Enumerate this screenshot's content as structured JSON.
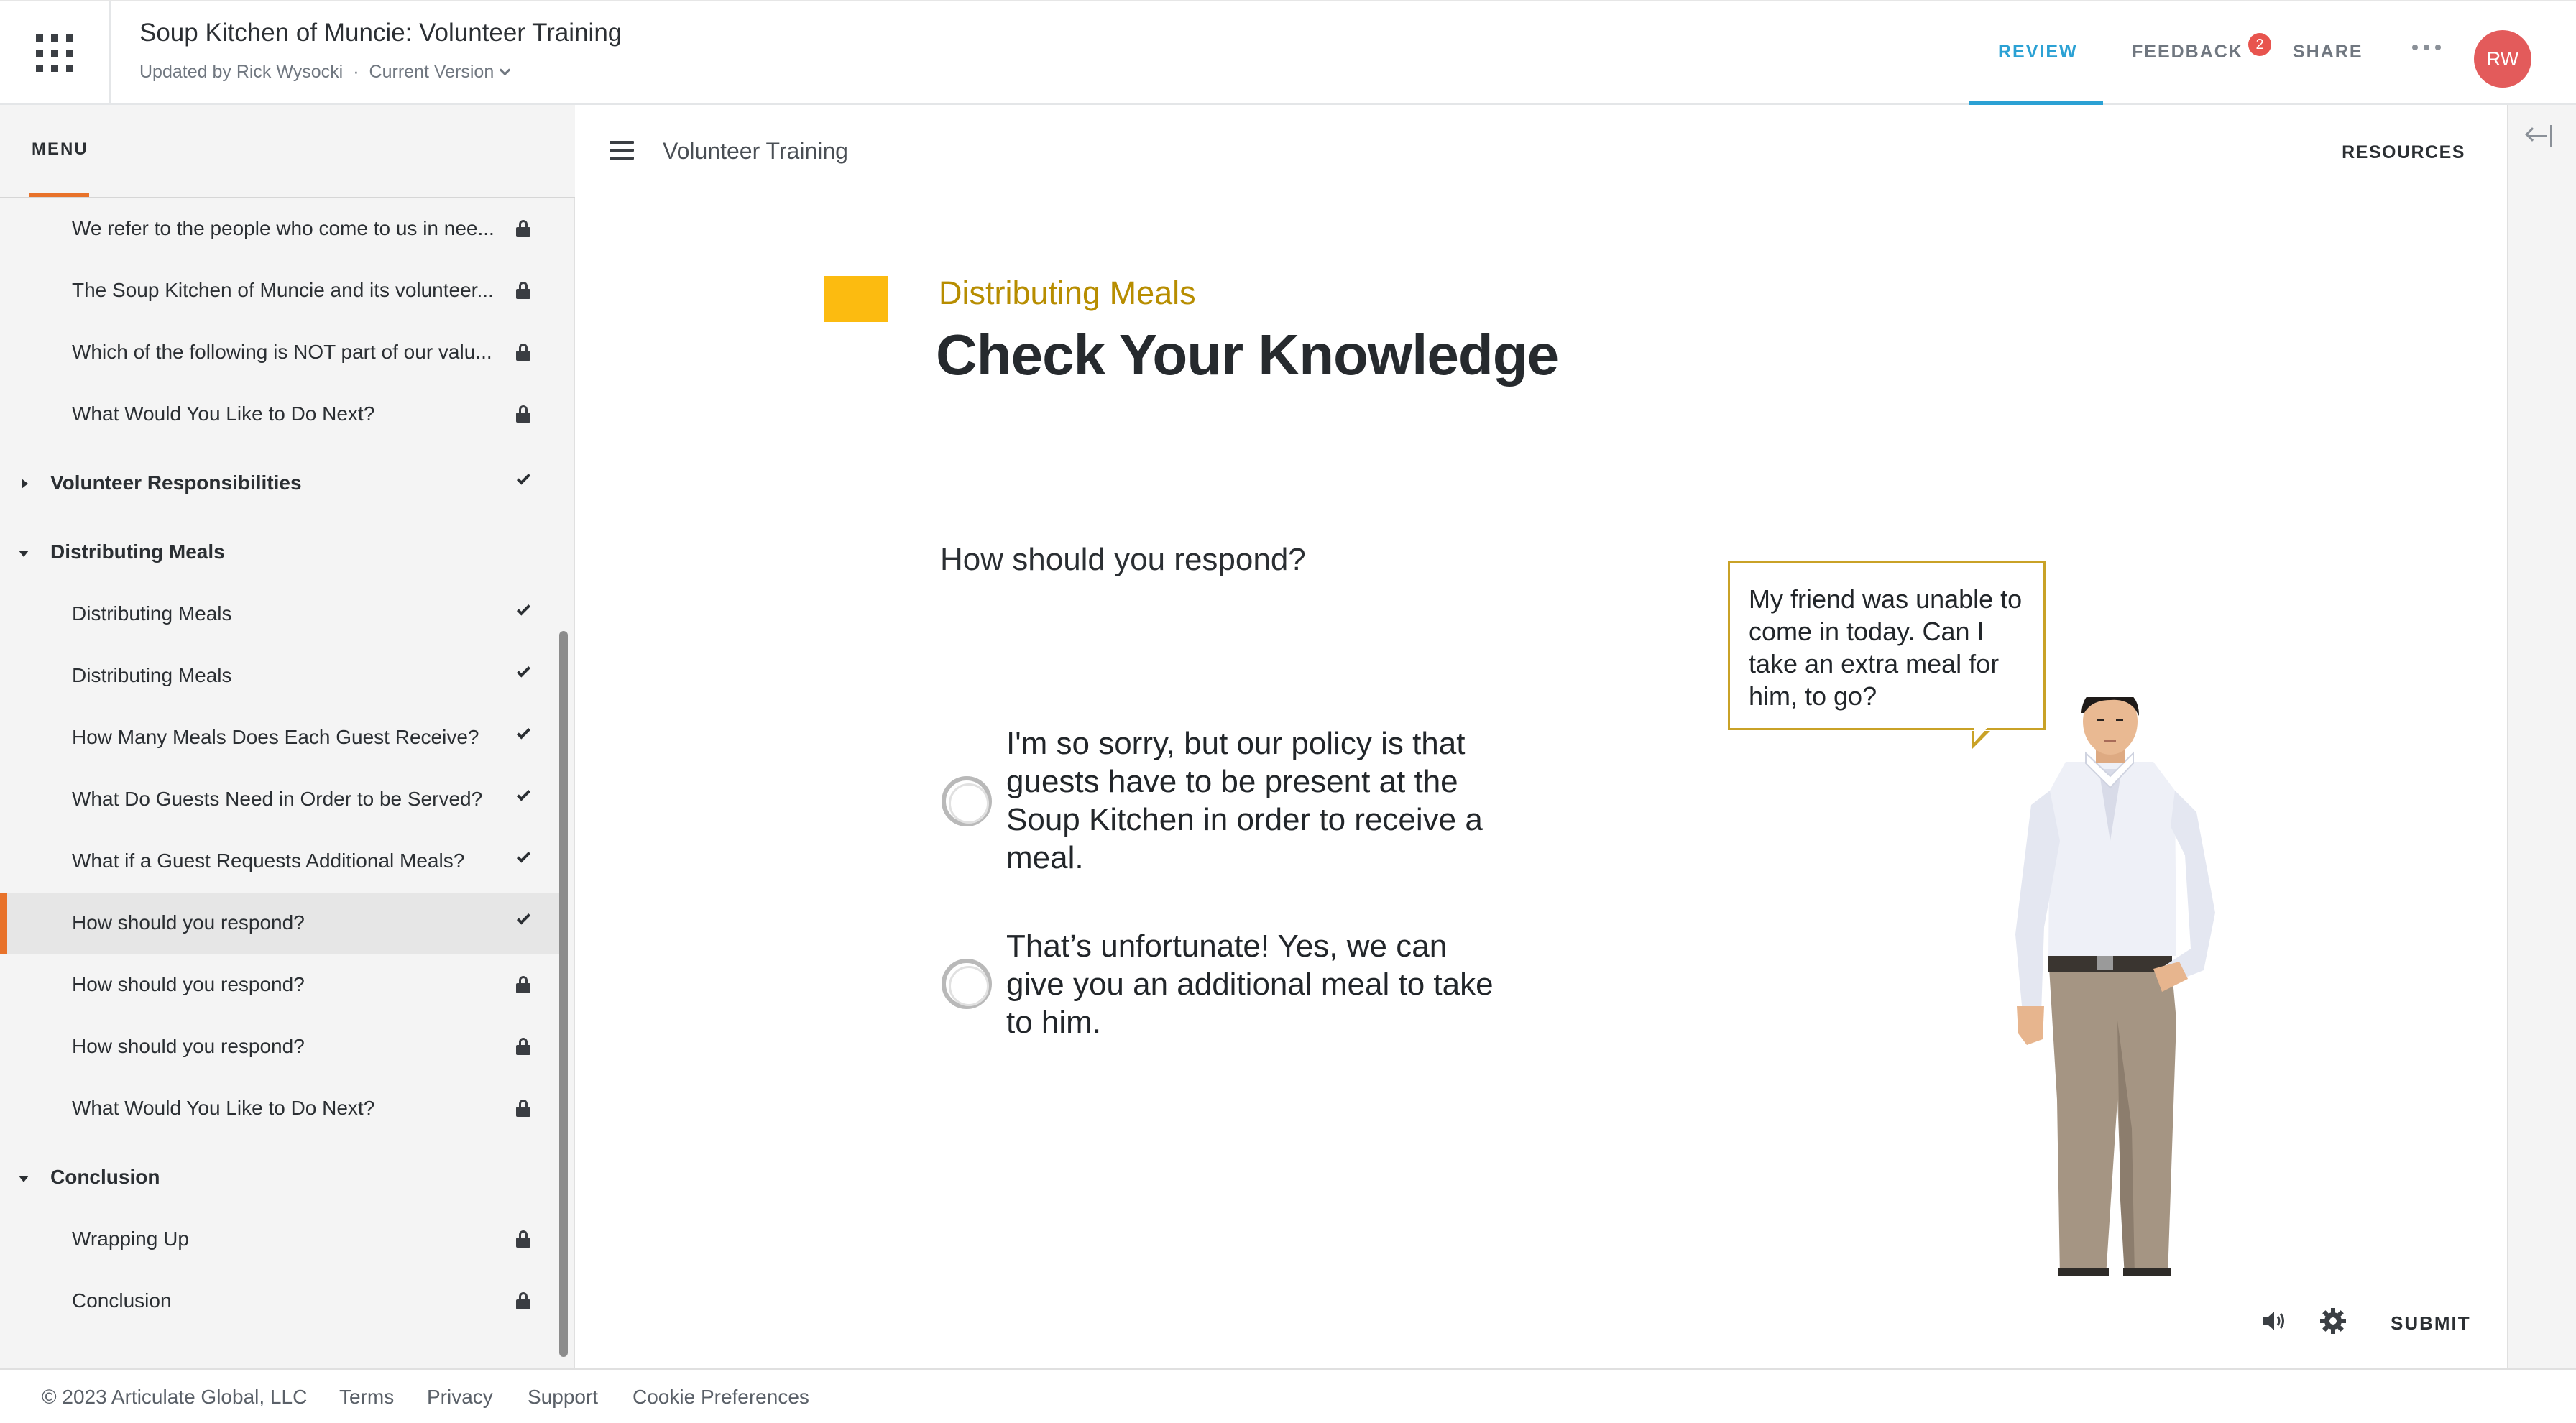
{
  "topbar": {
    "title": "Soup Kitchen of Muncie: Volunteer Training",
    "updated_by": "Updated by Rick Wysocki",
    "separator": "·",
    "version": "Current Version",
    "tabs": {
      "review": "REVIEW",
      "feedback": "FEEDBACK",
      "share": "SHARE"
    },
    "feedback_count": "2",
    "avatar_initials": "RW",
    "accent_color": "#2ba1d4"
  },
  "sidebar": {
    "menu_label": "MENU",
    "items": [
      {
        "label": "We refer to the people who come to us in nee...",
        "status": "locked",
        "kind": "lesson"
      },
      {
        "label": "The Soup Kitchen of Muncie and its volunteer...",
        "status": "locked",
        "kind": "lesson"
      },
      {
        "label": "Which of the following is NOT part of our valu...",
        "status": "locked",
        "kind": "lesson"
      },
      {
        "label": "What Would You Like to Do Next?",
        "status": "locked",
        "kind": "lesson"
      },
      {
        "label": "Volunteer Responsibilities",
        "status": "complete",
        "kind": "section",
        "expanded": false
      },
      {
        "label": "Distributing Meals",
        "status": "none",
        "kind": "section",
        "expanded": true
      },
      {
        "label": "Distributing Meals",
        "status": "complete",
        "kind": "lesson"
      },
      {
        "label": "Distributing Meals",
        "status": "complete",
        "kind": "lesson"
      },
      {
        "label": "How Many Meals Does Each Guest Receive?",
        "status": "complete",
        "kind": "lesson"
      },
      {
        "label": "What Do Guests Need in Order to be Served?",
        "status": "complete",
        "kind": "lesson"
      },
      {
        "label": "What if a Guest Requests Additional Meals?",
        "status": "complete",
        "kind": "lesson"
      },
      {
        "label": "How should you respond?",
        "status": "complete",
        "kind": "lesson",
        "active": true
      },
      {
        "label": "How should you respond?",
        "status": "locked",
        "kind": "lesson"
      },
      {
        "label": "How should you respond?",
        "status": "locked",
        "kind": "lesson"
      },
      {
        "label": "What Would You Like to Do Next?",
        "status": "locked",
        "kind": "lesson"
      },
      {
        "label": "Conclusion",
        "status": "none",
        "kind": "section",
        "expanded": true
      },
      {
        "label": "Wrapping Up",
        "status": "locked",
        "kind": "lesson"
      },
      {
        "label": "Conclusion",
        "status": "locked",
        "kind": "lesson"
      }
    ],
    "active_color": "#e8722a"
  },
  "lesson": {
    "header_title": "Volunteer Training",
    "resources_label": "RESOURCES",
    "kicker": "Distributing Meals",
    "heading": "Check Your Knowledge",
    "question": "How should you respond?",
    "choices": [
      "I'm so sorry, but our policy is that guests have to be present at the Soup Kitchen in order to receive a meal.",
      "That’s unfortunate! Yes, we can give you an additional meal to take to him."
    ],
    "speech_bubble": "My friend was unable to come in today. Can I take an extra meal for him, to go?",
    "submit_label": "SUBMIT",
    "accent_color": "#fcbb10",
    "kicker_color": "#b78d00"
  },
  "footer": {
    "copyright": "© 2023 Articulate Global, LLC",
    "links": [
      "Terms",
      "Privacy",
      "Support",
      "Cookie Preferences"
    ]
  }
}
